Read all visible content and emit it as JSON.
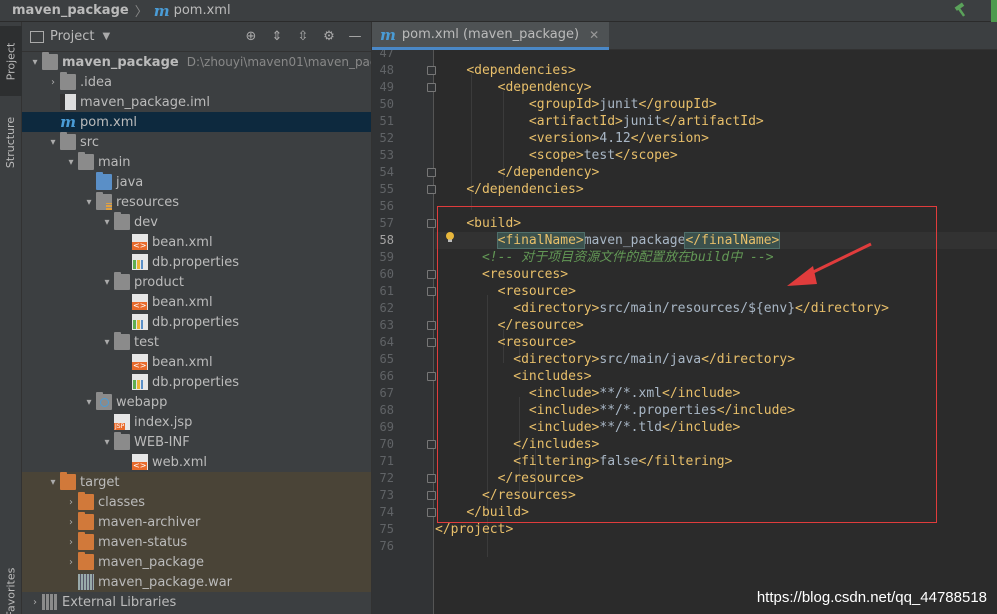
{
  "navbar": {
    "project": "maven_package",
    "file": "pom.xml"
  },
  "stripe": {
    "project_tab": "Project",
    "structure_tab": "Structure",
    "favorites_tab": "Favorites"
  },
  "project_panel": {
    "title": "Project",
    "tree": [
      {
        "label": "maven_package",
        "path": "D:\\zhouyi\\maven01\\maven_package"
      },
      {
        "label": ".idea"
      },
      {
        "label": "maven_package.iml"
      },
      {
        "label": "pom.xml"
      },
      {
        "label": "src"
      },
      {
        "label": "main"
      },
      {
        "label": "java"
      },
      {
        "label": "resources"
      },
      {
        "label": "dev"
      },
      {
        "label": "bean.xml"
      },
      {
        "label": "db.properties"
      },
      {
        "label": "product"
      },
      {
        "label": "bean.xml"
      },
      {
        "label": "db.properties"
      },
      {
        "label": "test"
      },
      {
        "label": "bean.xml"
      },
      {
        "label": "db.properties"
      },
      {
        "label": "webapp"
      },
      {
        "label": "index.jsp"
      },
      {
        "label": "WEB-INF"
      },
      {
        "label": "web.xml"
      },
      {
        "label": "target"
      },
      {
        "label": "classes"
      },
      {
        "label": "maven-archiver"
      },
      {
        "label": "maven-status"
      },
      {
        "label": "maven_package"
      },
      {
        "label": "maven_package.war"
      },
      {
        "label": "External Libraries"
      }
    ]
  },
  "editor": {
    "tab_label": "pom.xml (maven_package)",
    "first_line": 47,
    "current_line": 58,
    "lines": [
      {
        "n": "47",
        "parts": []
      },
      {
        "n": "48",
        "parts": [
          {
            "t": "    ",
            "c": "txt"
          },
          {
            "t": "<dependencies>",
            "c": "tag"
          }
        ]
      },
      {
        "n": "49",
        "parts": [
          {
            "t": "        ",
            "c": "txt"
          },
          {
            "t": "<dependency>",
            "c": "tag"
          }
        ]
      },
      {
        "n": "50",
        "parts": [
          {
            "t": "            ",
            "c": "txt"
          },
          {
            "t": "<groupId>",
            "c": "tag"
          },
          {
            "t": "junit",
            "c": "txt"
          },
          {
            "t": "</groupId>",
            "c": "tag"
          }
        ]
      },
      {
        "n": "51",
        "parts": [
          {
            "t": "            ",
            "c": "txt"
          },
          {
            "t": "<artifactId>",
            "c": "tag"
          },
          {
            "t": "junit",
            "c": "txt"
          },
          {
            "t": "</artifactId>",
            "c": "tag"
          }
        ]
      },
      {
        "n": "52",
        "parts": [
          {
            "t": "            ",
            "c": "txt"
          },
          {
            "t": "<version>",
            "c": "tag"
          },
          {
            "t": "4.12",
            "c": "txt"
          },
          {
            "t": "</version>",
            "c": "tag"
          }
        ]
      },
      {
        "n": "53",
        "parts": [
          {
            "t": "            ",
            "c": "txt"
          },
          {
            "t": "<scope>",
            "c": "tag"
          },
          {
            "t": "test",
            "c": "txt"
          },
          {
            "t": "</scope>",
            "c": "tag"
          }
        ]
      },
      {
        "n": "54",
        "parts": [
          {
            "t": "        ",
            "c": "txt"
          },
          {
            "t": "</dependency>",
            "c": "tag"
          }
        ]
      },
      {
        "n": "55",
        "parts": [
          {
            "t": "    ",
            "c": "txt"
          },
          {
            "t": "</dependencies>",
            "c": "tag"
          }
        ]
      },
      {
        "n": "56",
        "parts": []
      },
      {
        "n": "57",
        "parts": [
          {
            "t": "    ",
            "c": "txt"
          },
          {
            "t": "<build>",
            "c": "tag"
          }
        ]
      },
      {
        "n": "58",
        "parts": [
          {
            "t": "        ",
            "c": "txt"
          },
          {
            "t": "<finalName>",
            "c": "tag hl"
          },
          {
            "t": "maven_package",
            "c": "txt"
          },
          {
            "t": "</finalName>",
            "c": "tag hl"
          }
        ]
      },
      {
        "n": "59",
        "parts": [
          {
            "t": "      ",
            "c": "txt"
          },
          {
            "t": "<!-- 对于项目资源文件的配置放在build中 -->",
            "c": "cmt"
          }
        ]
      },
      {
        "n": "60",
        "parts": [
          {
            "t": "      ",
            "c": "txt"
          },
          {
            "t": "<resources>",
            "c": "tag"
          }
        ]
      },
      {
        "n": "61",
        "parts": [
          {
            "t": "        ",
            "c": "txt"
          },
          {
            "t": "<resource>",
            "c": "tag"
          }
        ]
      },
      {
        "n": "62",
        "parts": [
          {
            "t": "          ",
            "c": "txt"
          },
          {
            "t": "<directory>",
            "c": "tag"
          },
          {
            "t": "src/main/resources/${env}",
            "c": "txt"
          },
          {
            "t": "</directory>",
            "c": "tag"
          }
        ]
      },
      {
        "n": "63",
        "parts": [
          {
            "t": "        ",
            "c": "txt"
          },
          {
            "t": "</resource>",
            "c": "tag"
          }
        ]
      },
      {
        "n": "64",
        "parts": [
          {
            "t": "        ",
            "c": "txt"
          },
          {
            "t": "<resource>",
            "c": "tag"
          }
        ]
      },
      {
        "n": "65",
        "parts": [
          {
            "t": "          ",
            "c": "txt"
          },
          {
            "t": "<directory>",
            "c": "tag"
          },
          {
            "t": "src/main/java",
            "c": "txt"
          },
          {
            "t": "</directory>",
            "c": "tag"
          }
        ]
      },
      {
        "n": "66",
        "parts": [
          {
            "t": "          ",
            "c": "txt"
          },
          {
            "t": "<includes>",
            "c": "tag"
          }
        ]
      },
      {
        "n": "67",
        "parts": [
          {
            "t": "            ",
            "c": "txt"
          },
          {
            "t": "<include>",
            "c": "tag"
          },
          {
            "t": "**/*.xml",
            "c": "txt"
          },
          {
            "t": "</include>",
            "c": "tag"
          }
        ]
      },
      {
        "n": "68",
        "parts": [
          {
            "t": "            ",
            "c": "txt"
          },
          {
            "t": "<include>",
            "c": "tag"
          },
          {
            "t": "**/*.properties",
            "c": "txt"
          },
          {
            "t": "</include>",
            "c": "tag"
          }
        ]
      },
      {
        "n": "69",
        "parts": [
          {
            "t": "            ",
            "c": "txt"
          },
          {
            "t": "<include>",
            "c": "tag"
          },
          {
            "t": "**/*.tld",
            "c": "txt"
          },
          {
            "t": "</include>",
            "c": "tag"
          }
        ]
      },
      {
        "n": "70",
        "parts": [
          {
            "t": "          ",
            "c": "txt"
          },
          {
            "t": "</includes>",
            "c": "tag"
          }
        ]
      },
      {
        "n": "71",
        "parts": [
          {
            "t": "          ",
            "c": "txt"
          },
          {
            "t": "<filtering>",
            "c": "tag"
          },
          {
            "t": "false",
            "c": "txt"
          },
          {
            "t": "</filtering>",
            "c": "tag"
          }
        ]
      },
      {
        "n": "72",
        "parts": [
          {
            "t": "        ",
            "c": "txt"
          },
          {
            "t": "</resource>",
            "c": "tag"
          }
        ]
      },
      {
        "n": "73",
        "parts": [
          {
            "t": "      ",
            "c": "txt"
          },
          {
            "t": "</resources>",
            "c": "tag"
          }
        ]
      },
      {
        "n": "74",
        "parts": [
          {
            "t": "    ",
            "c": "txt"
          },
          {
            "t": "</build>",
            "c": "tag"
          }
        ]
      },
      {
        "n": "75",
        "parts": [
          {
            "t": "</project>",
            "c": "tag"
          }
        ]
      },
      {
        "n": "76",
        "parts": []
      }
    ]
  },
  "watermark": "https://blog.csdn.net/qq_44788518",
  "colors": {
    "tag": "#e8bf6a",
    "text": "#a9b7c6",
    "comment": "#629755",
    "highlight_box": "#e03c3c",
    "selection": "#0d293e"
  }
}
